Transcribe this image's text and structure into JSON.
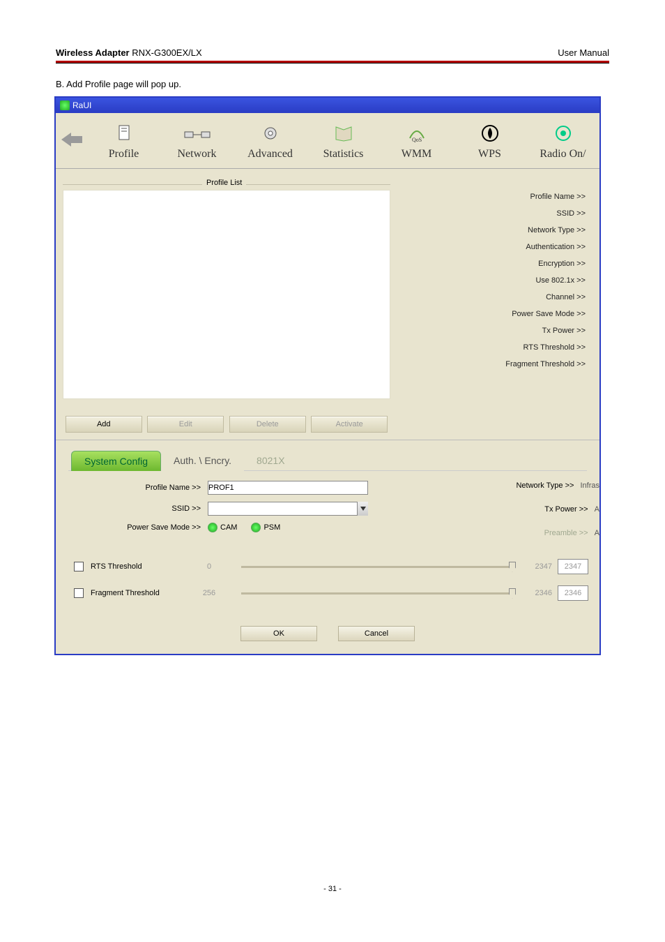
{
  "header": {
    "left_bold": "Wireless Adapter",
    "left_model": " RNX-G300EX/LX",
    "right": "User Manual"
  },
  "section_text": "B. Add Profile page will pop up.",
  "titlebar": "RaUI",
  "toolbar": {
    "items": [
      {
        "label": "Profile"
      },
      {
        "label": "Network"
      },
      {
        "label": "Advanced"
      },
      {
        "label": "Statistics"
      },
      {
        "label": "WMM"
      },
      {
        "label": "WPS"
      },
      {
        "label": "Radio On/"
      }
    ]
  },
  "profile_list_title": "Profile List",
  "pl_buttons": {
    "add": "Add",
    "edit": "Edit",
    "delete": "Delete",
    "activate": "Activate"
  },
  "details": [
    "Profile Name >>",
    "SSID >>",
    "Network Type >>",
    "Authentication >>",
    "Encryption >>",
    "Use 802.1x >>",
    "Channel >>",
    "Power Save Mode >>",
    "Tx Power >>",
    "RTS Threshold >>",
    "Fragment Threshold >>"
  ],
  "tabs": {
    "system": "System Config",
    "auth": "Auth. \\ Encry.",
    "x8021": "8021X"
  },
  "form": {
    "profile_name_lbl": "Profile Name >>",
    "profile_name_val": "PROF1",
    "ssid_lbl": "SSID >>",
    "ssid_val": "",
    "psm_lbl": "Power Save Mode >>",
    "cam": "CAM",
    "psm": "PSM",
    "network_type_lbl": "Network Type >>",
    "network_type_val": "Infras",
    "tx_power_lbl": "Tx Power >>",
    "tx_power_val": "A",
    "preamble_lbl": "Preamble >>",
    "preamble_val": "A"
  },
  "sliders": {
    "rts": {
      "label": "RTS Threshold",
      "min": "0",
      "max": "2347",
      "val": "2347"
    },
    "frag": {
      "label": "Fragment Threshold",
      "min": "256",
      "max": "2346",
      "val": "2346"
    }
  },
  "dlg": {
    "ok": "OK",
    "cancel": "Cancel"
  },
  "page_num": "- 31 -"
}
